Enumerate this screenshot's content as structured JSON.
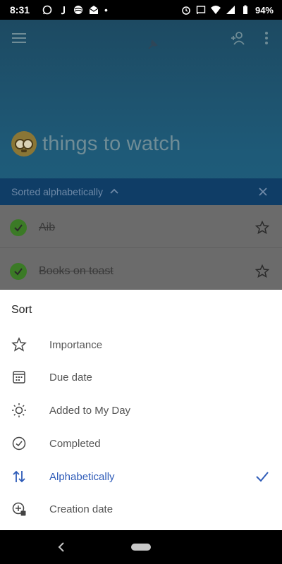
{
  "status_bar": {
    "time": "8:31",
    "battery": "94%",
    "dot": "•"
  },
  "list": {
    "title": "things to watch",
    "emoji_icon": "flushed-face-icon"
  },
  "sort_bar": {
    "label": "Sorted alphabetically"
  },
  "tasks": [
    {
      "title": "Aib",
      "completed": true
    },
    {
      "title": "Books on toast",
      "completed": true
    }
  ],
  "sheet": {
    "title": "Sort",
    "options": [
      {
        "label": "Importance",
        "icon": "star-icon",
        "selected": false
      },
      {
        "label": "Due date",
        "icon": "calendar-icon",
        "selected": false
      },
      {
        "label": "Added to My Day",
        "icon": "sun-icon",
        "selected": false
      },
      {
        "label": "Completed",
        "icon": "check-circle-icon",
        "selected": false
      },
      {
        "label": "Alphabetically",
        "icon": "sort-arrows-icon",
        "selected": true
      },
      {
        "label": "Creation date",
        "icon": "calendar-plus-icon",
        "selected": false
      }
    ]
  },
  "colors": {
    "accent": "#2e5bb8",
    "sort_bar_bg": "#0f3d66",
    "completed_green": "#3b7a26"
  }
}
